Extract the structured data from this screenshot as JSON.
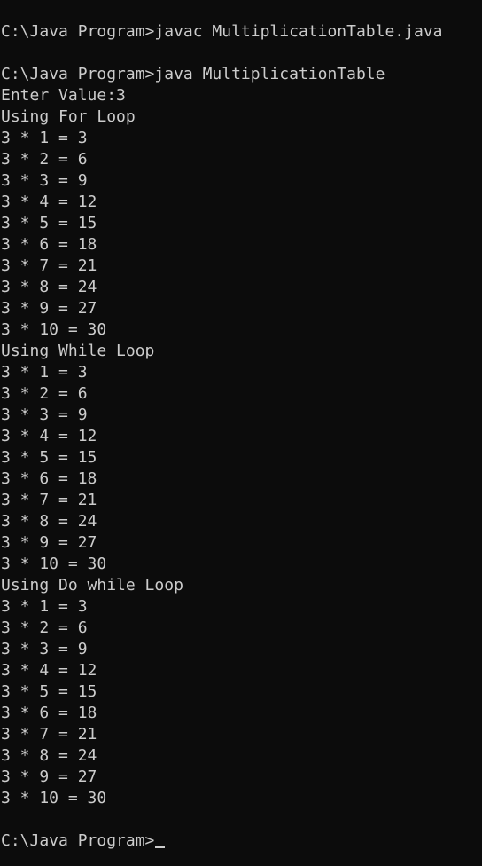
{
  "console": {
    "lines": [
      "C:\\Java Program>javac MultiplicationTable.java",
      "",
      "C:\\Java Program>java MultiplicationTable",
      "Enter Value:3",
      "Using For Loop",
      "3 * 1 = 3",
      "3 * 2 = 6",
      "3 * 3 = 9",
      "3 * 4 = 12",
      "3 * 5 = 15",
      "3 * 6 = 18",
      "3 * 7 = 21",
      "3 * 8 = 24",
      "3 * 9 = 27",
      "3 * 10 = 30",
      "Using While Loop",
      "3 * 1 = 3",
      "3 * 2 = 6",
      "3 * 3 = 9",
      "3 * 4 = 12",
      "3 * 5 = 15",
      "3 * 6 = 18",
      "3 * 7 = 21",
      "3 * 8 = 24",
      "3 * 9 = 27",
      "3 * 10 = 30",
      "Using Do while Loop",
      "3 * 1 = 3",
      "3 * 2 = 6",
      "3 * 3 = 9",
      "3 * 4 = 12",
      "3 * 5 = 15",
      "3 * 6 = 18",
      "3 * 7 = 21",
      "3 * 8 = 24",
      "3 * 9 = 27",
      "3 * 10 = 30",
      ""
    ],
    "prompt": "C:\\Java Program>"
  }
}
